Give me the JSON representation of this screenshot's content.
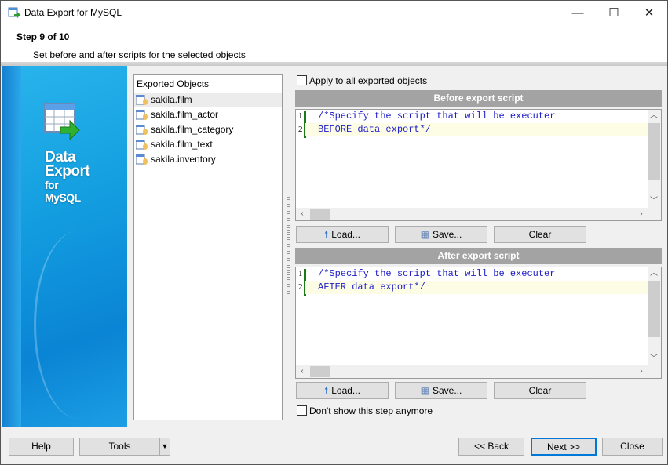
{
  "window": {
    "title": "Data Export for MySQL",
    "minimize": "—",
    "maximize": "☐",
    "close": "✕"
  },
  "header": {
    "step": "Step 9 of 10",
    "subtitle": "Set before and after scripts for the selected objects"
  },
  "banner": {
    "line1": "Data",
    "line2": "Export",
    "line3": "for",
    "line4": "MySQL"
  },
  "objects": {
    "header": "Exported Objects",
    "items": [
      "sakila.film",
      "sakila.film_actor",
      "sakila.film_category",
      "sakila.film_text",
      "sakila.inventory"
    ],
    "selected": "sakila.film"
  },
  "apply_all": {
    "label": "Apply to all exported objects",
    "checked": false
  },
  "before": {
    "title": "Before export script",
    "lines": [
      "/*Specify the script that will be executer",
      "BEFORE data export*/"
    ],
    "line_numbers": [
      "1",
      "2"
    ]
  },
  "after": {
    "title": "After export script",
    "lines": [
      "/*Specify the script that will be executer",
      "AFTER data export*/"
    ],
    "line_numbers": [
      "1",
      "2"
    ]
  },
  "buttons": {
    "load": "Load...",
    "save": "Save...",
    "clear": "Clear"
  },
  "dont_show": {
    "label": "Don't show this step anymore",
    "checked": false
  },
  "footer": {
    "help": "Help",
    "tools": "Tools",
    "back": "<< Back",
    "next": "Next >>",
    "close": "Close"
  }
}
